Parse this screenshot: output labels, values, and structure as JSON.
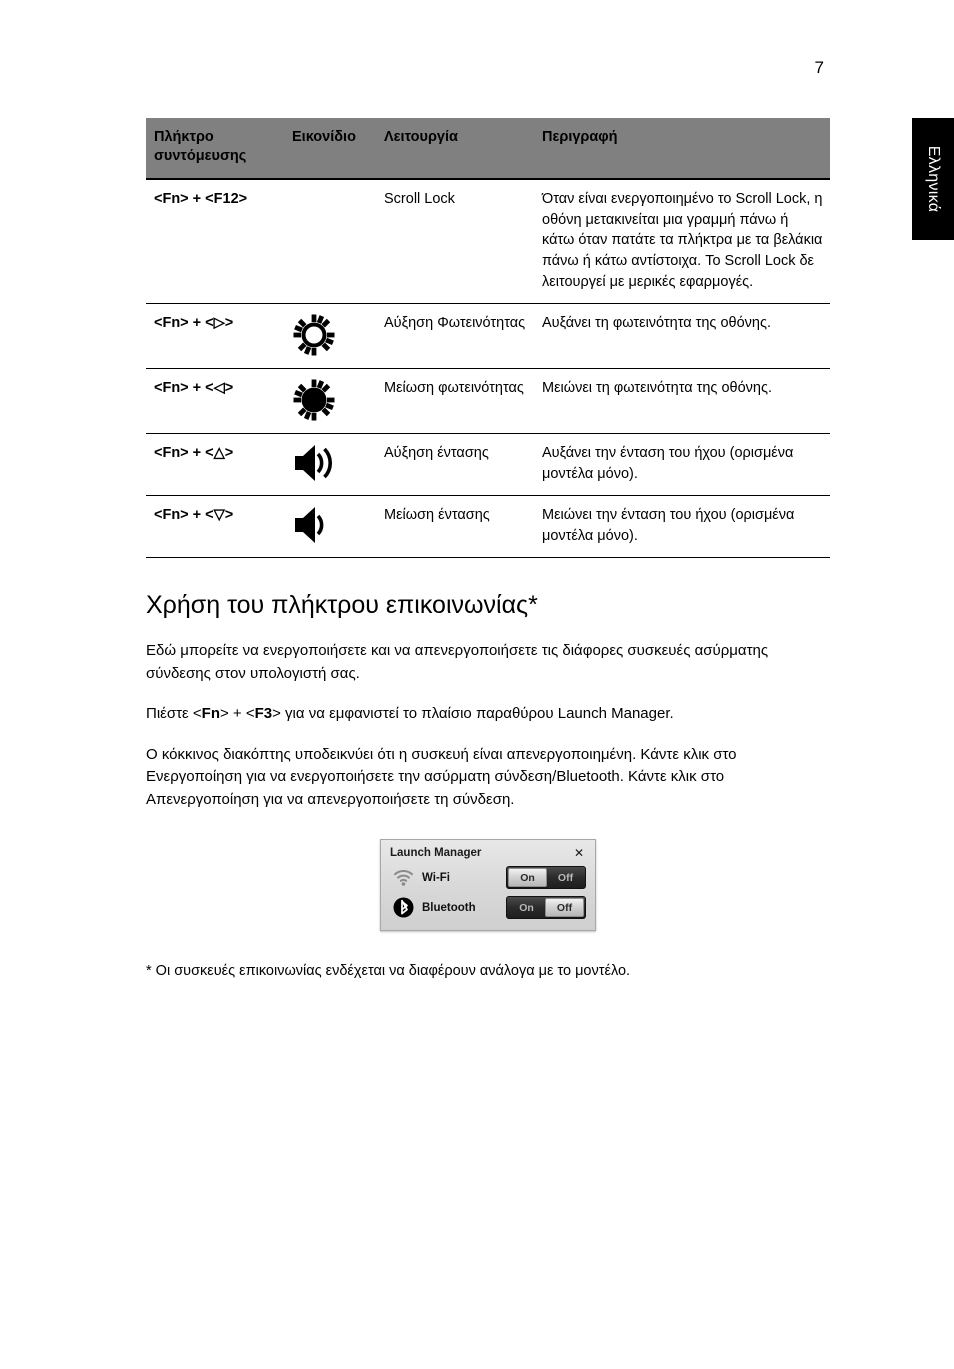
{
  "page": {
    "number": "7",
    "language_tab": "Ελληνικά"
  },
  "table": {
    "headers": {
      "key": "Πλήκτρο συντόμευσης",
      "icon": "Εικονίδιο",
      "function": "Λειτουργία",
      "description": "Περιγραφή"
    },
    "rows": [
      {
        "key": "<Fn> + <F12>",
        "icon": "none",
        "function": "Scroll Lock",
        "description": "Όταν είναι ενεργοποιημένο το Scroll Lock, η οθόνη μετακινείται μια γραμμή πάνω ή κάτω όταν πατάτε τα πλήκτρα με τα βελάκια πάνω ή κάτω αντίστοιχα. To Scroll Lock δε λειτουργεί με μερικές εφαρμογές."
      },
      {
        "key": "<Fn> + <▷>",
        "icon": "brightness-up-icon",
        "function": "Αύξηση Φωτεινότητας",
        "description": "Αυξάνει τη φωτεινότητα της οθόνης."
      },
      {
        "key": "<Fn> + <◁>",
        "icon": "brightness-down-icon",
        "function": "Μείωση φωτεινότητας",
        "description": "Μειώνει τη φωτεινότητα της οθόνης."
      },
      {
        "key": "<Fn> + <△>",
        "icon": "volume-up-icon",
        "function": "Αύξηση έντασης",
        "description": "Αυξάνει την ένταση του ήχου (ορισμένα μοντέλα μόνο)."
      },
      {
        "key": "<Fn> + <▽>",
        "icon": "volume-down-icon",
        "function": "Μείωση έντασης",
        "description": "Μειώνει την ένταση του ήχου (ορισμένα μοντέλα μόνο)."
      }
    ]
  },
  "section": {
    "heading": "Χρήση του πλήκτρου επικοινωνίας*",
    "paragraph1": "Εδώ μπορείτε να ενεργοποιήσετε και να απενεργοποιήσετε τις διάφορες συσκευές ασύρματης σύνδεσης στον υπολογιστή σας.",
    "paragraph2": {
      "part1": "Πιέστε <",
      "bold1": "Fn",
      "part2": "> + <",
      "bold2": "F3",
      "part3": "> για να εμφανιστεί το πλαίσιο παραθύρου Launch Manager."
    },
    "paragraph3": "Ο κόκκινος διακόπτης υποδεικνύει ότι η συσκευή είναι απενεργοποιημένη. Κάντε κλικ στο Ενεργοποίηση για να ενεργοποιήσετε την ασύρματη σύνδεση/Bluetooth. Κάντε κλικ στο Απενεργοποίηση για να απενεργοποιήσετε τη σύνδεση.",
    "footnote": "* Οι συσκευές επικοινωνίας ενδέχεται να διαφέρουν ανάλογα με το μοντέλο."
  },
  "dialog": {
    "title": "Launch Manager",
    "close_label": "✕",
    "rows": [
      {
        "icon": "wifi-icon",
        "label": "Wi-Fi",
        "on_label": "On",
        "off_label": "Off",
        "selected": "On"
      },
      {
        "icon": "bluetooth-icon",
        "label": "Bluetooth",
        "on_label": "On",
        "off_label": "Off",
        "selected": "Off"
      }
    ]
  },
  "colors": {
    "header_gray": "#808080",
    "dialog_bg": "#dcdcdc",
    "toggle_track": "#2b2b2b",
    "tab_black": "#000000"
  }
}
